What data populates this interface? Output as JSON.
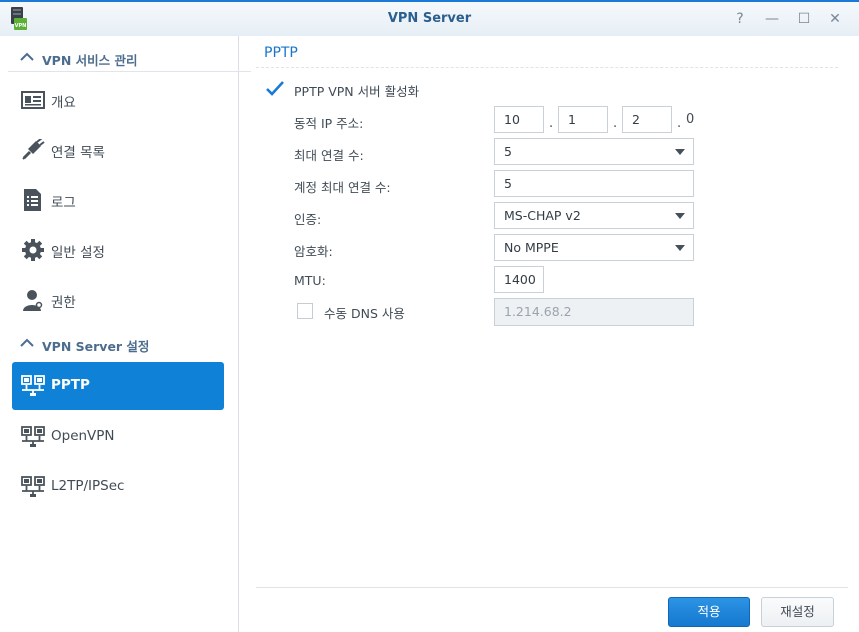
{
  "window": {
    "title": "VPN Server",
    "app_icon_text": "VPN",
    "controls": {
      "help": "?",
      "minimize": "—",
      "maximize": "☐",
      "close": "✕"
    }
  },
  "sidebar": {
    "section1": {
      "label": "VPN 서비스 관리",
      "items": [
        {
          "label": "개요",
          "icon": "overview-card-icon"
        },
        {
          "label": "연결 목록",
          "icon": "plug-icon"
        },
        {
          "label": "로그",
          "icon": "log-document-icon"
        },
        {
          "label": "일반 설정",
          "icon": "gear-icon"
        },
        {
          "label": "권한",
          "icon": "user-key-icon"
        }
      ]
    },
    "section2": {
      "label": "VPN Server 설정",
      "items": [
        {
          "label": "PPTP",
          "icon": "network-icon",
          "active": true
        },
        {
          "label": "OpenVPN",
          "icon": "network-icon"
        },
        {
          "label": "L2TP/IPSec",
          "icon": "network-icon"
        }
      ]
    }
  },
  "main": {
    "title": "PPTP",
    "enable_label": "PPTP VPN 서버 활성화",
    "enable_checked": true,
    "fields": {
      "dynamic_ip": {
        "label": "동적 IP 주소:",
        "octet1": "10",
        "octet2": "1",
        "octet3": "2",
        "octet4": "0",
        "separator": "."
      },
      "max_connections": {
        "label": "최대 연결 수:",
        "value": "5"
      },
      "max_per_account": {
        "label": "계정 최대 연결 수:",
        "value": "5"
      },
      "auth": {
        "label": "인증:",
        "value": "MS-CHAP v2"
      },
      "encryption": {
        "label": "암호화:",
        "value": "No MPPE"
      },
      "mtu": {
        "label": "MTU:",
        "value": "1400"
      },
      "manual_dns": {
        "label": "수동 DNS 사용",
        "checked": false,
        "value": "1.214.68.2"
      }
    }
  },
  "footer": {
    "apply_label": "적용",
    "reset_label": "재설정"
  },
  "colors": {
    "accent": "#0f82d8",
    "title_text": "#2a5f8f",
    "section_text": "#4d6d8f"
  }
}
